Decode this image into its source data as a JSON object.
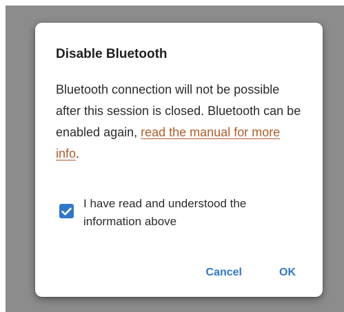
{
  "dialog": {
    "title": "Disable Bluetooth",
    "body_text": "Bluetooth connection will not be possible after this session is closed. Bluetooth can be enabled again, ",
    "link_text": "read the manual for more info",
    "body_suffix": ".",
    "checkbox_label": "I have read and understood the information above",
    "checkbox_checked": true,
    "cancel_label": "Cancel",
    "ok_label": "OK"
  },
  "colors": {
    "accent": "#2f78c9",
    "link": "#b25c2a",
    "scrim": "#8c8c8c"
  },
  "icons": {
    "checkbox": "checkmark-icon"
  }
}
